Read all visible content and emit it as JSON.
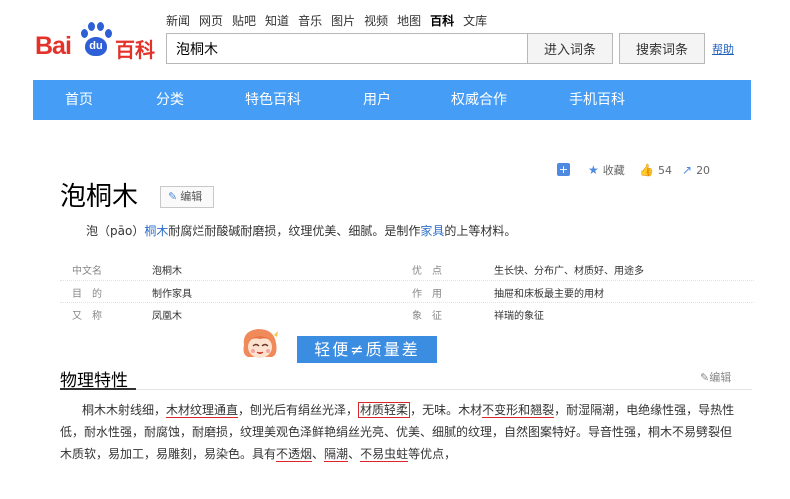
{
  "logo": {
    "bai": "Bai",
    "du": "du",
    "baike": "百科"
  },
  "top_nav": [
    "新闻",
    "网页",
    "贴吧",
    "知道",
    "音乐",
    "图片",
    "视频",
    "地图",
    "百科",
    "文库"
  ],
  "search": {
    "value": "泡桐木",
    "enter_label": "进入词条",
    "search_label": "搜索词条",
    "help": "帮助"
  },
  "main_nav": [
    "首页",
    "分类",
    "特色百科",
    "用户",
    "权威合作",
    "手机百科"
  ],
  "stats": {
    "fav_label": "收藏",
    "likes": "54",
    "shares": "20"
  },
  "entry": {
    "title": "泡桐木",
    "edit_label": "编辑",
    "summary": {
      "p1": "泡（pāo）",
      "link1": "桐木",
      "p2": "耐腐烂耐酸碱耐磨损，纹理优美、细腻。是制作",
      "link2": "家具",
      "p3": "的上等材料。"
    }
  },
  "info_rows": [
    {
      "k1": "中文名",
      "v1": "泡桐木",
      "k2": "优　点",
      "v2": "生长快、分布广、材质好、用途多"
    },
    {
      "k1": "目　的",
      "v1": "制作家具",
      "k2": "作　用",
      "v2": "抽屉和床板最主要的用材"
    },
    {
      "k1": "又　称",
      "v1": "凤凰木",
      "k2": "象　征",
      "v2": "祥瑞的象征"
    }
  ],
  "banner": "轻便≠质量差",
  "section": {
    "title": "物理特性",
    "edit_label": "编辑",
    "line1": {
      "a": "桐木木射线细，",
      "u1": "木材纹理通直",
      "b": "，刨光后有绢丝光泽，",
      "box": "材质轻柔",
      "c": "，无味。木材",
      "u2": "不变形和翘裂",
      "d": "，耐湿隔潮，电绝缘性强，导热性"
    },
    "line2": "低，耐水性强，耐腐蚀，耐磨损，纹理美观色泽鲜艳绢丝光亮、优美、细腻的纹理，自然图案特好。导音性强，桐木不易劈裂但",
    "line3": {
      "a": "木质软，易加工，易雕刻，易染色。具有",
      "u1": "不透烟",
      "b": "、",
      "u2": "隔潮",
      "c": "、",
      "u3": "不易虫蛀",
      "d": "等优点，"
    }
  },
  "colors": {
    "nav_blue": "#459df5",
    "brand_red": "#e4322b",
    "brand_blue": "#2e5fd6",
    "mark_red": "#d9262c"
  }
}
